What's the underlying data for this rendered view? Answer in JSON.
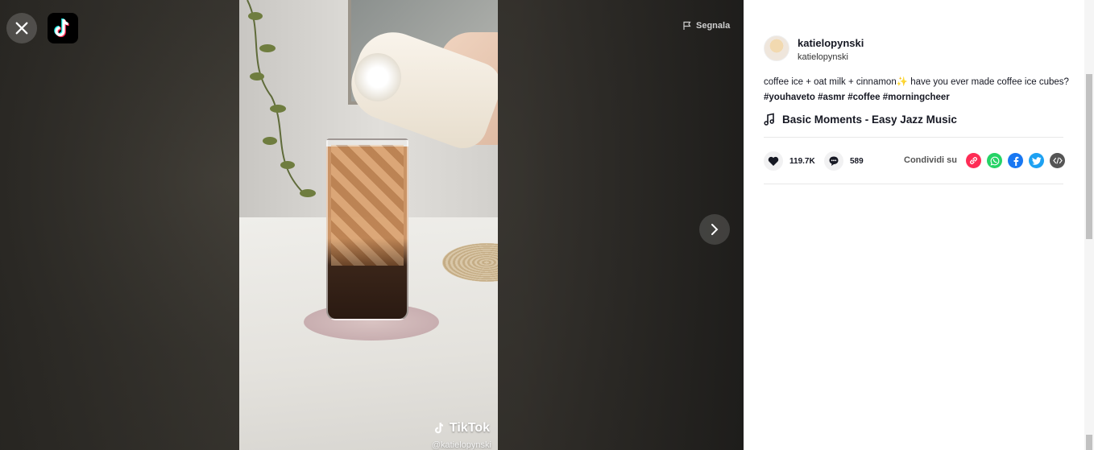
{
  "report": {
    "label": "Segnala"
  },
  "video": {
    "watermark_brand": "TikTok",
    "watermark_handle": "@katielopynski"
  },
  "author": {
    "name": "katielopynski",
    "nickname": "katielopynski"
  },
  "description": {
    "text": "coffee ice + oat milk + cinnamon✨ have you ever made coffee ice cubes?",
    "tags": [
      "#youhaveto",
      "#asmr",
      "#coffee",
      "#morningcheer"
    ]
  },
  "music": {
    "title": "Basic Moments - Easy Jazz Music"
  },
  "stats": {
    "likes": "119.7K",
    "comments": "589"
  },
  "share": {
    "label": "Condividi su",
    "targets": [
      {
        "name": "link",
        "color": "#fe2c55"
      },
      {
        "name": "whatsapp",
        "color": "#25d366"
      },
      {
        "name": "facebook",
        "color": "#1877f2"
      },
      {
        "name": "twitter",
        "color": "#1da1f2"
      },
      {
        "name": "embed",
        "color": "#555555"
      }
    ]
  }
}
